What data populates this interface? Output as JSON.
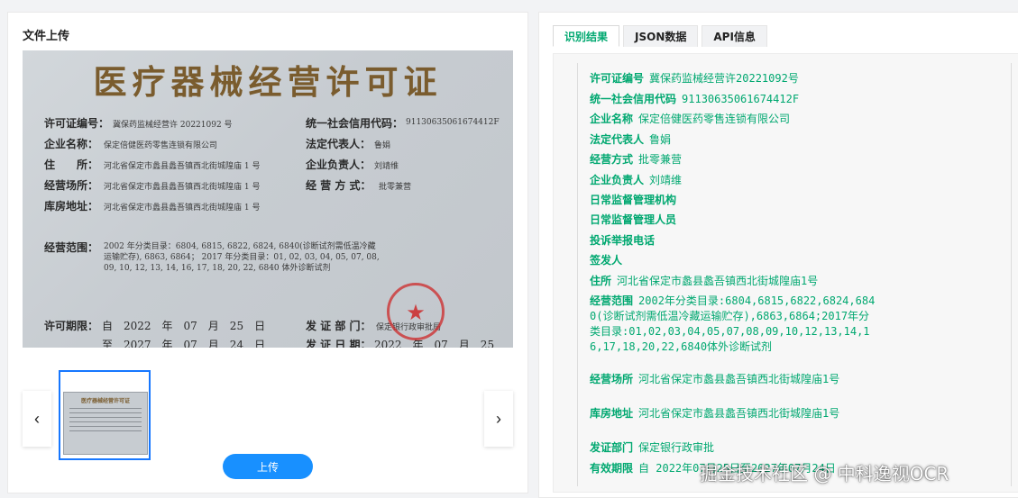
{
  "left": {
    "title": "文件上传",
    "upload_label": "上传",
    "prev_icon": "‹",
    "next_icon": "›"
  },
  "license": {
    "title": "医疗器械经营许可证",
    "fields": {
      "license_no_label": "许可证编号：",
      "license_no_value": "冀保药监械经营许 20221092 号",
      "credit_label": "统一社会信用代码：",
      "credit_value": "91130635061674412F",
      "company_label": "企业名称：",
      "company_value": "保定倍健医药零售连锁有限公司",
      "legal_label": "法定代表人：",
      "legal_value": "鲁娟",
      "address_label": "住　　所：",
      "address_value": "河北省保定市蠡县蠡吾镇西北街城隍庙 1 号",
      "manager_label": "企业负责人：",
      "manager_value": "刘靖维",
      "site_label": "经营场所：",
      "site_value": "河北省保定市蠡县蠡吾镇西北街城隍庙 1 号",
      "mode_label": "经 营 方 式：",
      "mode_value": "批零兼营",
      "warehouse_label": "库房地址：",
      "warehouse_value": "河北省保定市蠡县蠡吾镇西北街城隍庙 1 号",
      "scope_label": "经营范围：",
      "scope_value": "2002 年分类目录：6804, 6815, 6822, 6824, 6840(诊断试剂需低温冷藏运输贮存), 6863, 6864； 2017 年分类目录：01, 02, 03, 04, 05, 07, 08, 09, 10, 12, 13, 14, 16, 17, 18, 20, 22, 6840 体外诊断试剂",
      "period_label": "许可期限：",
      "period_from": "自　2022　年　07　月　25　日",
      "period_to": "至　2027　年　07　月　24　日",
      "dept_label": "发 证 部 门：",
      "dept_value": "保定银行政审批局",
      "date_label": "发 证 日 期：",
      "date_value": "2022　年　07　月　25"
    },
    "thumb_title": "医疗器械经营许可证"
  },
  "tabs": [
    "识别结果",
    "JSON数据",
    "API信息"
  ],
  "results": [
    {
      "k": "许可证编号",
      "v": "冀保药监械经营许20221092号"
    },
    {
      "k": "统一社会信用代码",
      "v": "91130635061674412F"
    },
    {
      "k": "企业名称",
      "v": "保定倍健医药零售连锁有限公司"
    },
    {
      "k": "法定代表人",
      "v": "鲁娟"
    },
    {
      "k": "经营方式",
      "v": "批零兼营"
    },
    {
      "k": "企业负责人",
      "v": "刘靖维"
    },
    {
      "k": "日常监督管理机构",
      "v": ""
    },
    {
      "k": "日常监督管理人员",
      "v": ""
    },
    {
      "k": "投诉举报电话",
      "v": ""
    },
    {
      "k": "签发人",
      "v": ""
    },
    {
      "k": "住所",
      "v": "河北省保定市蠡县蠡吾镇西北街城隍庙1号"
    },
    {
      "k": "经营范围",
      "v": "2002年分类目录:6804,6815,6822,6824,6840(诊断试剂需低温冷藏运输贮存),6863,6864;2017年分类目录:01,02,03,04,05,07,08,09,10,12,13,14,16,17,18,20,22,6840体外诊断试剂"
    },
    {
      "k": "经营场所",
      "v": "河北省保定市蠡县蠡吾镇西北街城隍庙1号"
    },
    {
      "k": "库房地址",
      "v": "河北省保定市蠡县蠡吾镇西北街城隍庙1号"
    },
    {
      "k": "发证部门",
      "v": "保定银行政审批"
    },
    {
      "k": "有效期限",
      "v": "自 2022年07月25日至2027年07月24日"
    }
  ],
  "watermark": "掘金技术社区 @ 中科逸视OCR"
}
